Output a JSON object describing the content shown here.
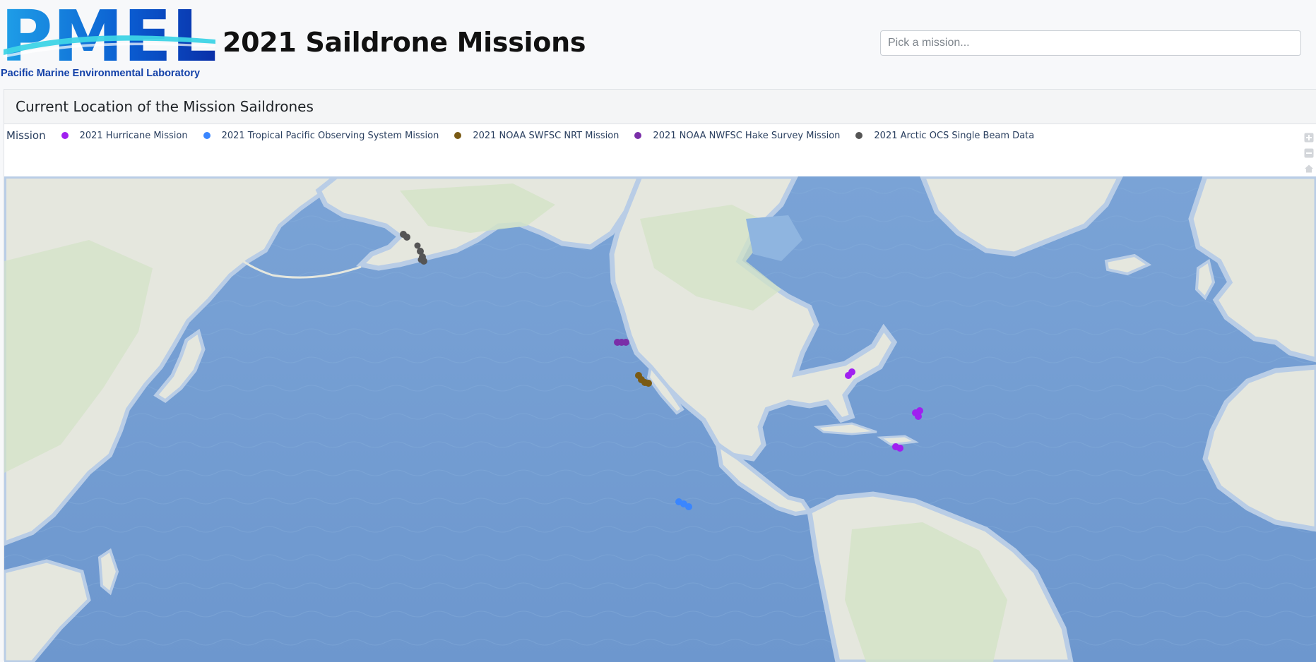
{
  "header": {
    "logo_text": "PMEL",
    "logo_subtitle": "Pacific Marine Environmental Laboratory",
    "title": "2021 Saildrone Missions",
    "mission_picker_placeholder": "Pick a mission...",
    "mission_picker_value": ""
  },
  "card": {
    "title": "Current Location of the Mission Saildrones"
  },
  "legend": {
    "title": "Mission",
    "items": [
      {
        "label": "2021 Hurricane Mission",
        "color": "#a020f0"
      },
      {
        "label": "2021 Tropical Pacific Observing System Mission",
        "color": "#3a86ff"
      },
      {
        "label": "2021 NOAA SWFSC NRT Mission",
        "color": "#7a5a14"
      },
      {
        "label": "2021 NOAA NWFSC Hake Survey Mission",
        "color": "#7a2ea8"
      },
      {
        "label": "2021 Arctic OCS Single Beam Data",
        "color": "#555555"
      }
    ]
  },
  "modebar": {
    "buttons": [
      "zoom-in-icon",
      "zoom-out-icon",
      "home-icon",
      "pan-icon",
      "camera-icon"
    ]
  },
  "map": {
    "basemap": "ocean-bathymetry",
    "colors": {
      "ocean": "#6f9ad0",
      "deep_ocean": "#5d88c2",
      "shelf": "#a9c7e8",
      "land": "#e6e8df",
      "land_green": "#cfe0c2"
    }
  }
}
